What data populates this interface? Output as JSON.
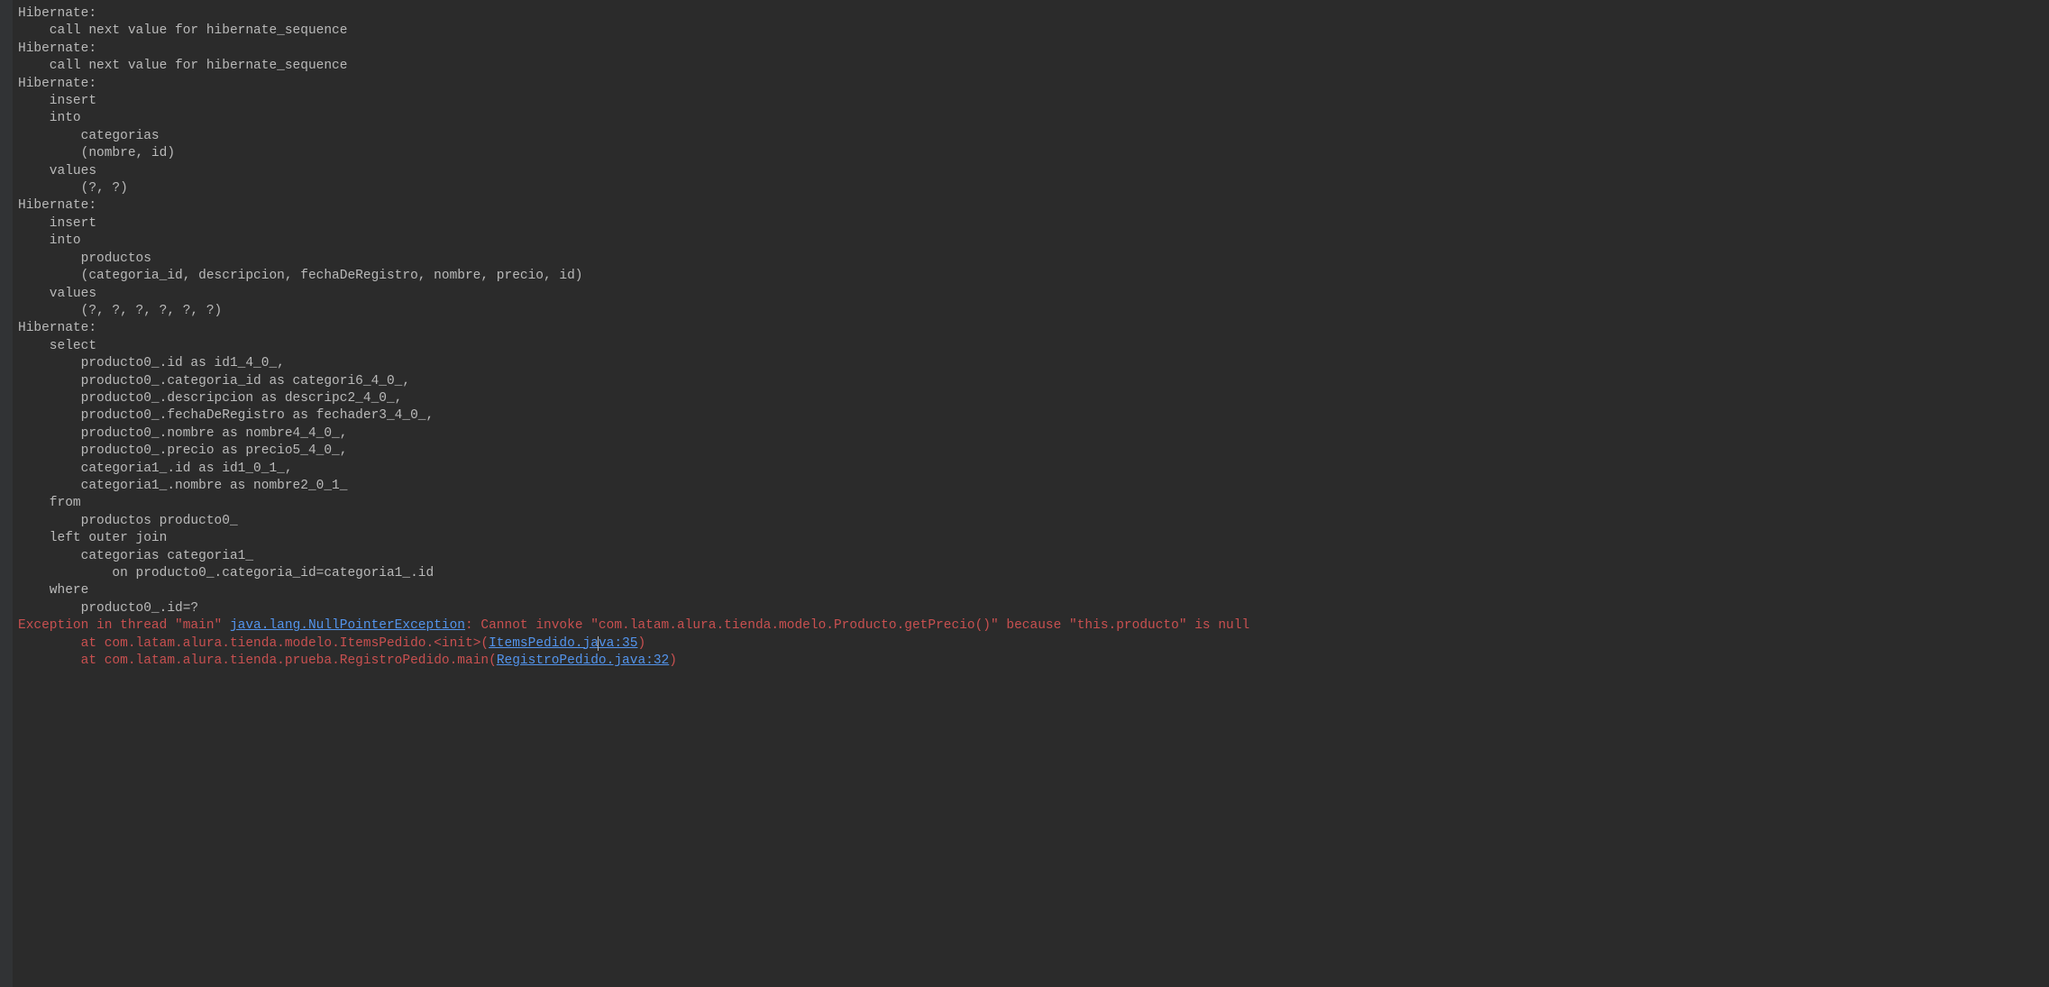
{
  "sql": {
    "block1_prefix": "Hibernate: ",
    "block1_body": "\n    call next value for hibernate_sequence",
    "block2_prefix": "Hibernate: ",
    "block2_body": "\n    call next value for hibernate_sequence",
    "block3_prefix": "Hibernate: ",
    "block3_body": "\n    insert \n    into\n        categorias\n        (nombre, id) \n    values\n        (?, ?)",
    "block4_prefix": "Hibernate: ",
    "block4_body": "\n    insert \n    into\n        productos\n        (categoria_id, descripcion, fechaDeRegistro, nombre, precio, id) \n    values\n        (?, ?, ?, ?, ?, ?)",
    "block5_prefix": "Hibernate: ",
    "block5_body": "\n    select\n        producto0_.id as id1_4_0_,\n        producto0_.categoria_id as categori6_4_0_,\n        producto0_.descripcion as descripc2_4_0_,\n        producto0_.fechaDeRegistro as fechader3_4_0_,\n        producto0_.nombre as nombre4_4_0_,\n        producto0_.precio as precio5_4_0_,\n        categoria1_.id as id1_0_1_,\n        categoria1_.nombre as nombre2_0_1_ \n    from\n        productos producto0_ \n    left outer join\n        categorias categoria1_ \n            on producto0_.categoria_id=categoria1_.id \n    where\n        producto0_.id=?"
  },
  "exc": {
    "pre1": "Exception in thread \"main\" ",
    "link1": "java.lang.NullPointerException",
    "post1": ": Cannot invoke \"com.latam.alura.tienda.modelo.Producto.getPrecio()\" because \"this.producto\" is null",
    "at2": "\tat com.latam.alura.tienda.modelo.ItemsPedido.<init>(",
    "file2a": "ItemsPedido.ja",
    "file2b": "va:35",
    "close2": ")",
    "at3": "\tat com.latam.alura.tienda.prueba.RegistroPedido.main(",
    "file3": "RegistroPedido.java:32",
    "close3": ")"
  }
}
